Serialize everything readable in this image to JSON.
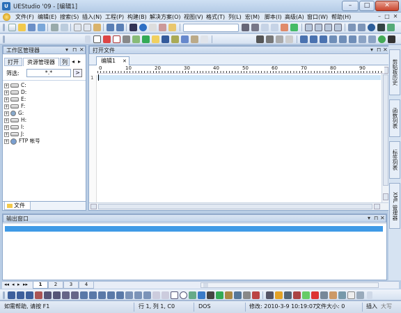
{
  "window": {
    "title": "UEStudio '09 - [编辑1]",
    "app_icon_text": "U",
    "minimize_glyph": "–",
    "maximize_glyph": "□",
    "close_glyph": "✕"
  },
  "menubar": {
    "items": [
      "文件(F)",
      "编辑(E)",
      "搜索(S)",
      "插入(N)",
      "工程(P)",
      "构建(B)",
      "解决方案(O)",
      "视图(V)",
      "格式(T)",
      "列(L)",
      "宏(M)",
      "脚本(I)",
      "高级(A)",
      "窗口(W)",
      "帮助(H)"
    ],
    "mdi_glyphs": [
      "–",
      "□",
      "✕"
    ]
  },
  "left_pane": {
    "title": "工作区管理器",
    "controls": [
      "▾",
      "⊓",
      "✕"
    ],
    "tabs": [
      "打开",
      "资源管理器",
      "列表"
    ],
    "tab_scroll": [
      "◂",
      "▸"
    ],
    "filter_label": "筛选:",
    "filter_value": "*.*",
    "filter_btn": ">",
    "tree": [
      "C:",
      "D:",
      "E:",
      "F:",
      "G:",
      "H:",
      "I:",
      "J:",
      "FTP 帐号"
    ],
    "bottom_tab": "文件"
  },
  "editor": {
    "pane_title": "打开文件",
    "controls": [
      "▾",
      "⊓",
      "✕"
    ],
    "tab_label": "编辑1",
    "tab_close": "✕",
    "ruler_numbers": [
      "0",
      "10",
      "20",
      "30",
      "40",
      "50",
      "60",
      "70",
      "80",
      "90"
    ],
    "line_number": "1"
  },
  "output_pane": {
    "title": "输出窗口",
    "controls": [
      "▾",
      "⊓",
      "✕"
    ]
  },
  "right_strip": {
    "tabs": [
      "剪贴板历史",
      "函数列表",
      "标签列表",
      "XML 管理器"
    ]
  },
  "bottom_tabs": {
    "nav": [
      "◂◂",
      "◂",
      "▸",
      "▸▸"
    ],
    "tabs": [
      "1",
      "2",
      "3",
      "4"
    ]
  },
  "statusbar": {
    "help": "如需帮助, 请按 F1",
    "position": "行 1, 列 1, C0",
    "line_ending": "DOS",
    "modified": "修改: 2010-3-9 10:19:07",
    "filesize": "文件大小: 0",
    "insert_mode": "插入",
    "caps": "大写"
  },
  "colors": {
    "selection_bar": "#3f9ae6",
    "current_line": "#cfe6f8"
  }
}
